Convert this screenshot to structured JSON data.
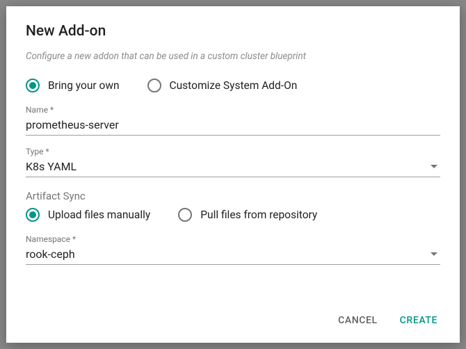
{
  "title": "New Add-on",
  "subtitle": "Configure a new addon that can be used in a custom cluster blueprint",
  "mode_radio": {
    "option1": "Bring your own",
    "option2": "Customize System Add-On"
  },
  "fields": {
    "name": {
      "label": "Name *",
      "value": "prometheus-server"
    },
    "type": {
      "label": "Type *",
      "value": "K8s YAML"
    },
    "namespace": {
      "label": "Namespace *",
      "value": "rook-ceph"
    }
  },
  "artifact_sync": {
    "label": "Artifact Sync",
    "option1": "Upload files manually",
    "option2": "Pull files from repository"
  },
  "actions": {
    "cancel": "Cancel",
    "create": "Create"
  }
}
